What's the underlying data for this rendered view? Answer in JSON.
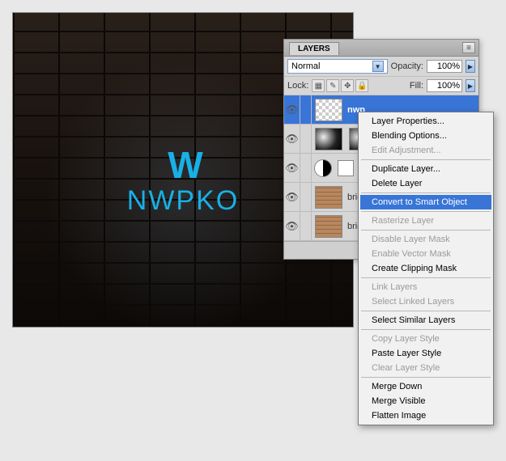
{
  "canvas": {
    "logo_text": "W",
    "neon_text": "NWPKO"
  },
  "layers_panel": {
    "title": "LAYERS",
    "blend_mode": "Normal",
    "opacity_label": "Opacity:",
    "opacity_value": "100%",
    "lock_label": "Lock:",
    "fill_label": "Fill:",
    "fill_value": "100%",
    "layers": [
      {
        "name": "nwp",
        "selected": true,
        "thumb": "checker",
        "mask": null
      },
      {
        "name": "",
        "thumb": "clouds",
        "mask": "clouds"
      },
      {
        "name": "",
        "thumb": "adj",
        "mask": "white"
      },
      {
        "name": "brick",
        "thumb": "brick"
      },
      {
        "name": "brick",
        "thumb": "brick"
      }
    ]
  },
  "context_menu": {
    "items": [
      {
        "label": "Layer Properties...",
        "enabled": true
      },
      {
        "label": "Blending Options...",
        "enabled": true
      },
      {
        "label": "Edit Adjustment...",
        "enabled": false
      },
      {
        "sep": true
      },
      {
        "label": "Duplicate Layer...",
        "enabled": true
      },
      {
        "label": "Delete Layer",
        "enabled": true
      },
      {
        "sep": true
      },
      {
        "label": "Convert to Smart Object",
        "enabled": true,
        "highlighted": true
      },
      {
        "sep": true
      },
      {
        "label": "Rasterize Layer",
        "enabled": false
      },
      {
        "sep": true
      },
      {
        "label": "Disable Layer Mask",
        "enabled": false
      },
      {
        "label": "Enable Vector Mask",
        "enabled": false
      },
      {
        "label": "Create Clipping Mask",
        "enabled": true
      },
      {
        "sep": true
      },
      {
        "label": "Link Layers",
        "enabled": false
      },
      {
        "label": "Select Linked Layers",
        "enabled": false
      },
      {
        "sep": true
      },
      {
        "label": "Select Similar Layers",
        "enabled": true
      },
      {
        "sep": true
      },
      {
        "label": "Copy Layer Style",
        "enabled": false
      },
      {
        "label": "Paste Layer Style",
        "enabled": true
      },
      {
        "label": "Clear Layer Style",
        "enabled": false
      },
      {
        "sep": true
      },
      {
        "label": "Merge Down",
        "enabled": true
      },
      {
        "label": "Merge Visible",
        "enabled": true
      },
      {
        "label": "Flatten Image",
        "enabled": true
      }
    ]
  }
}
